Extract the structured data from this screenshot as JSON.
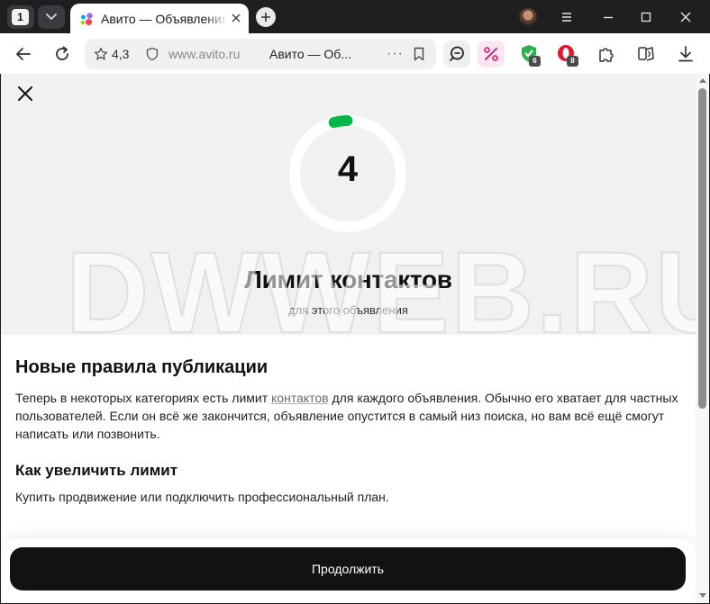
{
  "browser": {
    "tab_count": "1",
    "active_tab_title": "Авито — Объявления на сайте Авито",
    "rating": "4,3",
    "url": "www.avito.ru",
    "page_title": "Авито — Об...",
    "more_dots": "···",
    "ext_badge_1": "6",
    "ext_badge_2": "8"
  },
  "colors": {
    "accent_green": "#00b84a",
    "button_dark": "#121212"
  },
  "modal": {
    "counter": "4",
    "counter_progress": 0.04,
    "title": "Лимит контактов",
    "subtitle": "для этого объявления",
    "heading": "Новые правила публикации",
    "para_before_link": "Теперь в некоторых категориях есть лимит ",
    "para_link": "контактов",
    "para_after_link": " для каждого объявления. Обычно его хватает для частных пользователей. Если он всё же закончится, объявление опустится в самый низ поиска, но вам всё ещё смогут написать или позвонить.",
    "subheading": "Как увеличить лимит",
    "para2": "Купить продвижение или подключить профессиональный план.",
    "cta": "Продолжить"
  },
  "watermark": "DWWEB.RU",
  "icons": [
    "tab-list-icon",
    "avito-logo-icon",
    "close-icon",
    "plus-icon",
    "menu-icon",
    "minimize-icon",
    "maximize-icon",
    "window-close-icon",
    "back-icon",
    "reload-icon",
    "star-icon",
    "shield-icon",
    "bookmark-icon",
    "search-chat-icon",
    "discount-icon",
    "extension-icon",
    "puzzle-icon",
    "collections-icon",
    "download-icon"
  ]
}
